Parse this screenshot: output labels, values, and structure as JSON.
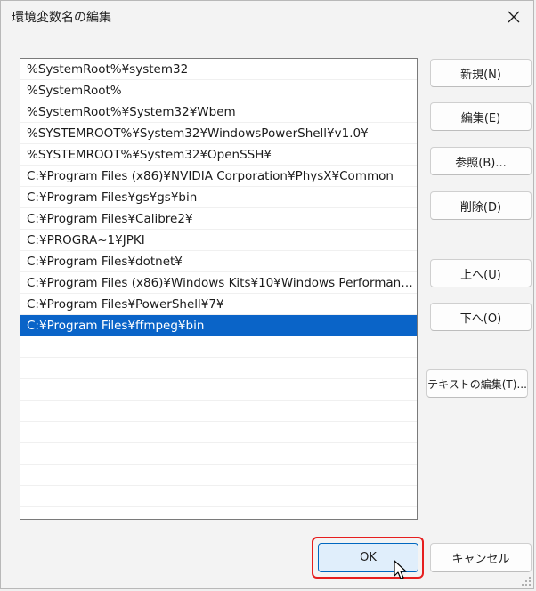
{
  "window": {
    "title": "環境変数名の編集"
  },
  "list": {
    "items": [
      "%SystemRoot%¥system32",
      "%SystemRoot%",
      "%SystemRoot%¥System32¥Wbem",
      "%SYSTEMROOT%¥System32¥WindowsPowerShell¥v1.0¥",
      "%SYSTEMROOT%¥System32¥OpenSSH¥",
      "C:¥Program Files (x86)¥NVIDIA Corporation¥PhysX¥Common",
      "C:¥Program Files¥gs¥gs¥bin",
      "C:¥Program Files¥Calibre2¥",
      "C:¥PROGRA~1¥JPKI",
      "C:¥Program Files¥dotnet¥",
      "C:¥Program Files (x86)¥Windows Kits¥10¥Windows Performance...",
      "C:¥Program Files¥PowerShell¥7¥",
      "C:¥Program Files¥ffmpeg¥bin"
    ],
    "selected_index": 12,
    "selection_color": "#0a64c8"
  },
  "buttons": {
    "new": "新規(N)",
    "edit": "編集(E)",
    "browse": "参照(B)...",
    "delete": "削除(D)",
    "up": "上へ(U)",
    "down": "下へ(O)",
    "edit_text": "テキストの編集(T)...",
    "ok": "OK",
    "cancel": "キャンセル"
  },
  "icons": {
    "close": "close-icon",
    "cursor": "mouse-pointer-icon",
    "grip": "resize-grip-icon"
  },
  "colors": {
    "highlight": "#e61e1e",
    "ok_border": "#0067c0"
  }
}
